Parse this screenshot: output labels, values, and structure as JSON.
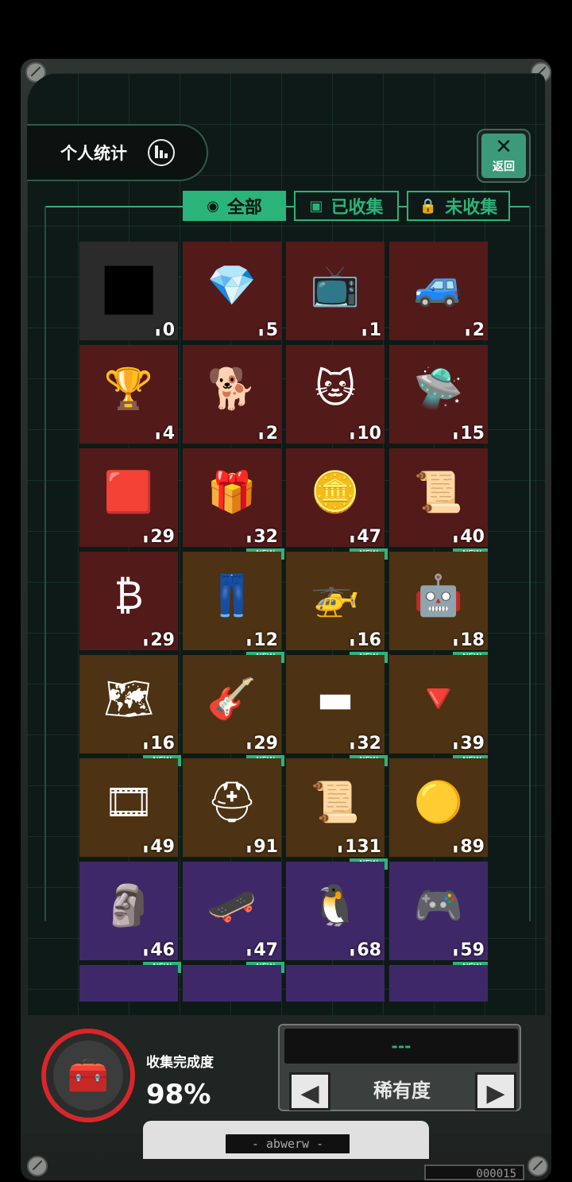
{
  "header": {
    "stats_label": "个人统计",
    "back_label": "返回"
  },
  "tabs": [
    {
      "label": "全部",
      "icon": "filter-icon",
      "active": true
    },
    {
      "label": "已收集",
      "icon": "collected-icon",
      "active": false
    },
    {
      "label": "未收集",
      "icon": "lock-icon",
      "active": false
    }
  ],
  "items": [
    {
      "count": "0",
      "bg": "#2b2b2b",
      "icon": "mystery-silhouette-icon",
      "new": false
    },
    {
      "count": "5",
      "bg": "#531a1a",
      "icon": "crystal-gem-icon",
      "new": false
    },
    {
      "count": "1",
      "bg": "#531a1a",
      "icon": "retro-tv-icon",
      "new": false
    },
    {
      "count": "2",
      "bg": "#531a1a",
      "icon": "sports-car-icon",
      "new": false
    },
    {
      "count": "4",
      "bg": "#531a1a",
      "icon": "goblet-icon",
      "new": false
    },
    {
      "count": "2",
      "bg": "#531a1a",
      "icon": "dog-statue-icon",
      "new": false
    },
    {
      "count": "10",
      "bg": "#531a1a",
      "icon": "cat-mascot-icon",
      "new": false
    },
    {
      "count": "15",
      "bg": "#531a1a",
      "icon": "robot-drone-icon",
      "new": false
    },
    {
      "count": "29",
      "bg": "#531a1a",
      "icon": "red-card-icon",
      "new": false
    },
    {
      "count": "32",
      "bg": "#531a1a",
      "icon": "gift-box-icon",
      "new": true
    },
    {
      "count": "47",
      "bg": "#531a1a",
      "icon": "silver-coin-icon",
      "new": true
    },
    {
      "count": "40",
      "bg": "#531a1a",
      "icon": "certificate-icon",
      "new": true
    },
    {
      "count": "29",
      "bg": "#531a1a",
      "icon": "bitcoin-icon",
      "new": false
    },
    {
      "count": "12",
      "bg": "#4d3213",
      "icon": "overalls-icon",
      "new": true
    },
    {
      "count": "16",
      "bg": "#4d3213",
      "icon": "quadcopter-icon",
      "new": true
    },
    {
      "count": "18",
      "bg": "#4d3213",
      "icon": "robot-dog-icon",
      "new": true
    },
    {
      "count": "16",
      "bg": "#4d3213",
      "icon": "star-map-icon",
      "new": true
    },
    {
      "count": "29",
      "bg": "#4d3213",
      "icon": "electric-guitar-icon",
      "new": true
    },
    {
      "count": "32",
      "bg": "#4d3213",
      "icon": "gold-bar-icon",
      "new": true
    },
    {
      "count": "39",
      "bg": "#4d3213",
      "icon": "spinning-top-icon",
      "new": true
    },
    {
      "count": "49",
      "bg": "#4d3213",
      "icon": "film-reel-icon",
      "new": false
    },
    {
      "count": "91",
      "bg": "#4d3213",
      "icon": "helmet-icon",
      "new": false
    },
    {
      "count": "131",
      "bg": "#4d3213",
      "icon": "certificate-icon",
      "new": true
    },
    {
      "count": "89",
      "bg": "#4d3213",
      "icon": "gold-nugget-icon",
      "new": false
    },
    {
      "count": "46",
      "bg": "#3f2868",
      "icon": "terracotta-warrior-icon",
      "new": true
    },
    {
      "count": "47",
      "bg": "#3f2868",
      "icon": "hover-board-icon",
      "new": true
    },
    {
      "count": "68",
      "bg": "#3f2868",
      "icon": "penguin-squad-icon",
      "new": false
    },
    {
      "count": "59",
      "bg": "#3f2868",
      "icon": "bmo-robot-icon",
      "new": true
    },
    {
      "count": "",
      "bg": "#3f2868",
      "icon": "partial-item-icon",
      "new": false
    },
    {
      "count": "",
      "bg": "#3f2868",
      "icon": "partial-item-icon",
      "new": false
    },
    {
      "count": "",
      "bg": "#3f2868",
      "icon": "partial-item-icon",
      "new": false
    },
    {
      "count": "",
      "bg": "#3f2868",
      "icon": "partial-item-icon",
      "new": false
    }
  ],
  "new_badge_label": "NEW",
  "footer": {
    "completion_label": "收集完成度",
    "completion_value": "98%",
    "completion_percent": 98,
    "rarity_screen_text": "---",
    "rarity_label": "稀有度",
    "plate_label": "- abwerw -",
    "serial": "000015"
  },
  "colors": {
    "accent": "#2ab47a",
    "ring": "#d8262a"
  }
}
